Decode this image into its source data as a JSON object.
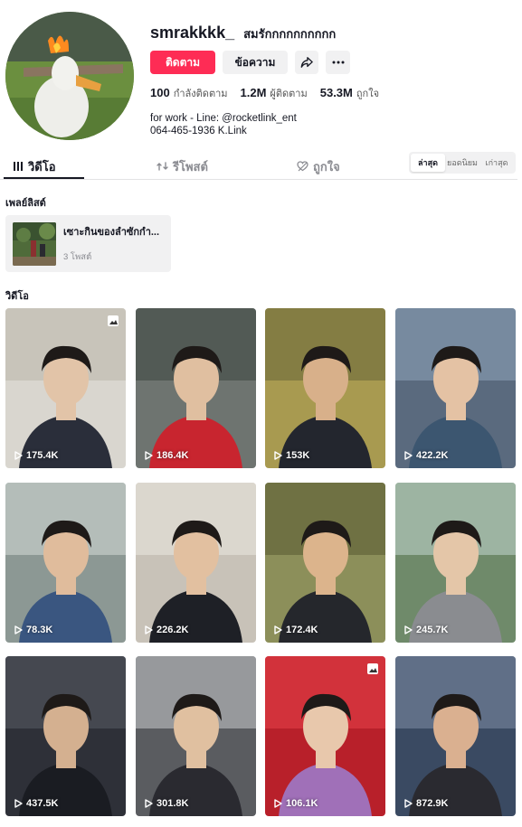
{
  "profile": {
    "username": "smrakkkk_",
    "nickname": "สมรักกกกกกกกกก",
    "follow_label": "ติดตาม",
    "message_label": "ข้อความ",
    "stats": {
      "following_count": "100",
      "following_label": "กำลังติดตาม",
      "followers_count": "1.2M",
      "followers_label": "ผู้ติดตาม",
      "likes_count": "53.3M",
      "likes_label": "ถูกใจ"
    },
    "bio_line1": "for work - Line: @rocketlink_ent",
    "bio_line2": "064-465-1936 K.Link"
  },
  "tabs": {
    "videos": "วิดีโอ",
    "reposts": "รีโพสต์",
    "liked": "ถูกใจ"
  },
  "sort": {
    "latest": "ล่าสุด",
    "popular": "ยอดนิยม",
    "oldest": "เก่าสุด"
  },
  "playlists": {
    "title": "เพลย์ลิสต์",
    "items": [
      {
        "name": "เซาะกินของลำซักกำ...",
        "count": "3 โพสต์"
      }
    ]
  },
  "videos": {
    "title": "วิดีโอ",
    "items": [
      {
        "views": "175.4K",
        "multi": true
      },
      {
        "views": "186.4K",
        "multi": false
      },
      {
        "views": "153K",
        "multi": false
      },
      {
        "views": "422.2K",
        "multi": false
      },
      {
        "views": "78.3K",
        "multi": false
      },
      {
        "views": "226.2K",
        "multi": false
      },
      {
        "views": "172.4K",
        "multi": false
      },
      {
        "views": "245.7K",
        "multi": false
      },
      {
        "views": "437.5K",
        "multi": false
      },
      {
        "views": "301.8K",
        "multi": false
      },
      {
        "views": "106.1K",
        "multi": true
      },
      {
        "views": "872.9K",
        "multi": false
      }
    ]
  },
  "colors": {
    "accent": "#fe2c55",
    "text": "#161823",
    "muted": "#8a8b91",
    "surface": "#f1f1f2"
  }
}
